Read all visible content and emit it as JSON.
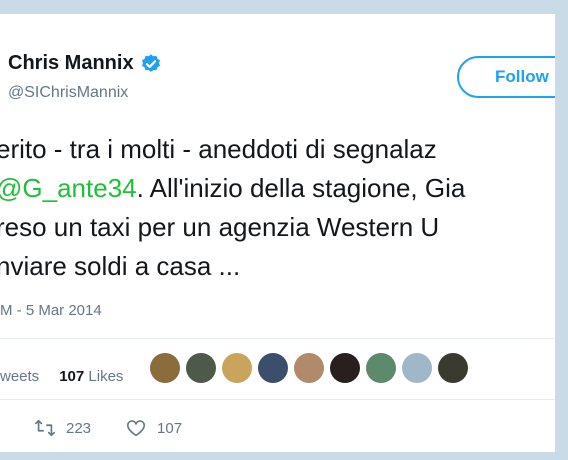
{
  "profile": {
    "name": "Chris Mannix",
    "handle": "@SIChrisMannix"
  },
  "follow_label": "Follow",
  "tweet": {
    "line1": "erito - tra i molti - aneddoti di segnalaz",
    "line2_mention": "G_ante34",
    "line2_rest": ". All'inizio della stagione, Gia",
    "line3": "reso un taxi per un agenzia Western U",
    "line4": "nviare soldi a casa ..."
  },
  "timestamp": "M - 5 Mar 2014",
  "stats": {
    "retweets_label": "weets",
    "likes_count": "107",
    "likes_label": "Likes"
  },
  "actions": {
    "retweet_count": "223",
    "like_count": "107"
  },
  "colors": {
    "accent": "#1da1f2",
    "mention": "#1fbf3a",
    "text": "#14171a",
    "muted": "#657786"
  },
  "avatar_colors": [
    "#8a6d3b",
    "#4d5a4a",
    "#c9a45a",
    "#3b4e6b",
    "#b08a6a",
    "#2a1f1f",
    "#5d8a6a",
    "#9fb7c9",
    "#3a3a2e"
  ]
}
